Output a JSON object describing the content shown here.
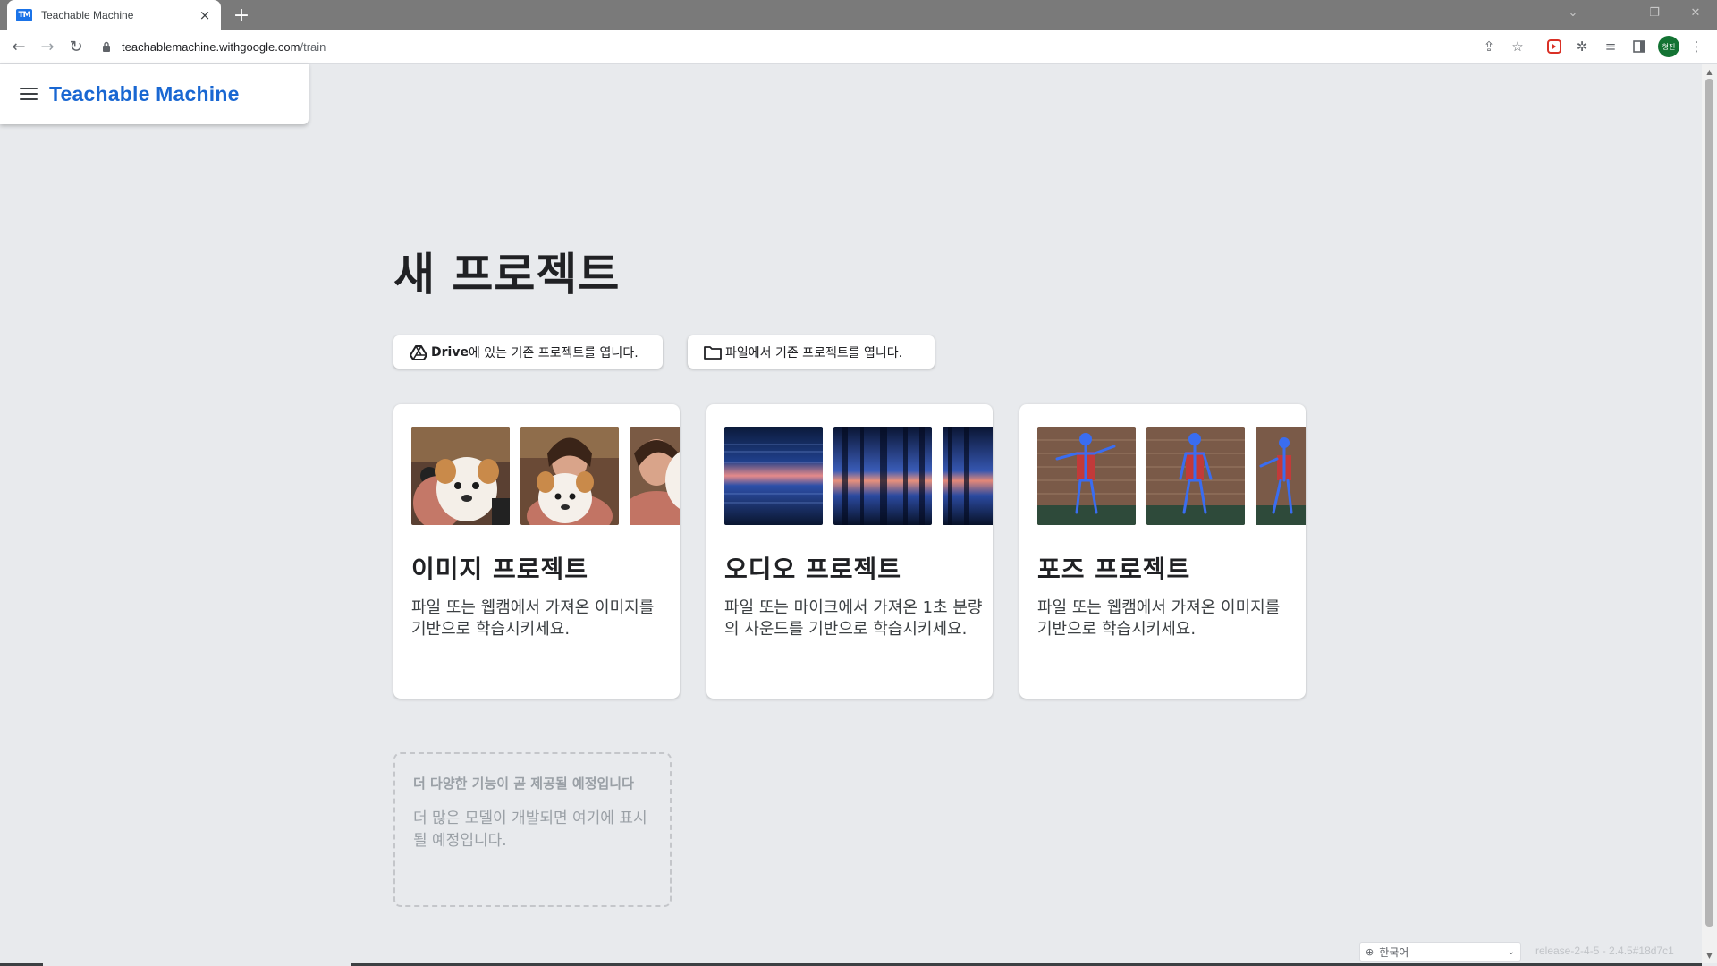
{
  "browser": {
    "tab_title": "Teachable Machine",
    "favicon_text": "TM",
    "url_host": "teachablemachine.withgoogle.com",
    "url_path": "/train",
    "profile_initials": "형진"
  },
  "header": {
    "logo": "Teachable Machine"
  },
  "main": {
    "title": "새 프로젝트",
    "open_drive": {
      "brand": "Drive",
      "label": "에 있는 기존 프로젝트를 엽니다."
    },
    "open_file": {
      "label": "파일에서 기존 프로젝트를 엽니다."
    },
    "projects": [
      {
        "title": "이미지 프로젝트",
        "description": "파일 또는 웹캠에서 가져온 이미지를 기반으로 학습시키세요."
      },
      {
        "title": "오디오 프로젝트",
        "description": "파일 또는 마이크에서 가져온 1초 분량의 사운드를 기반으로 학습시키세요."
      },
      {
        "title": "포즈 프로젝트",
        "description": "파일 또는 웹캠에서 가져온 이미지를 기반으로 학습시키세요."
      }
    ],
    "coming_soon": {
      "title": "더 다양한 기능이 곧 제공될 예정입니다",
      "description": "더 많은 모델이 개발되면 여기에 표시될 예정입니다."
    }
  },
  "footer": {
    "language": "한국어",
    "release": "release-2-4-5 - 2.4.5#18d7c1"
  },
  "colors": {
    "accent": "#1967d2",
    "page_bg": "#e8eaed",
    "card_bg": "#ffffff"
  }
}
